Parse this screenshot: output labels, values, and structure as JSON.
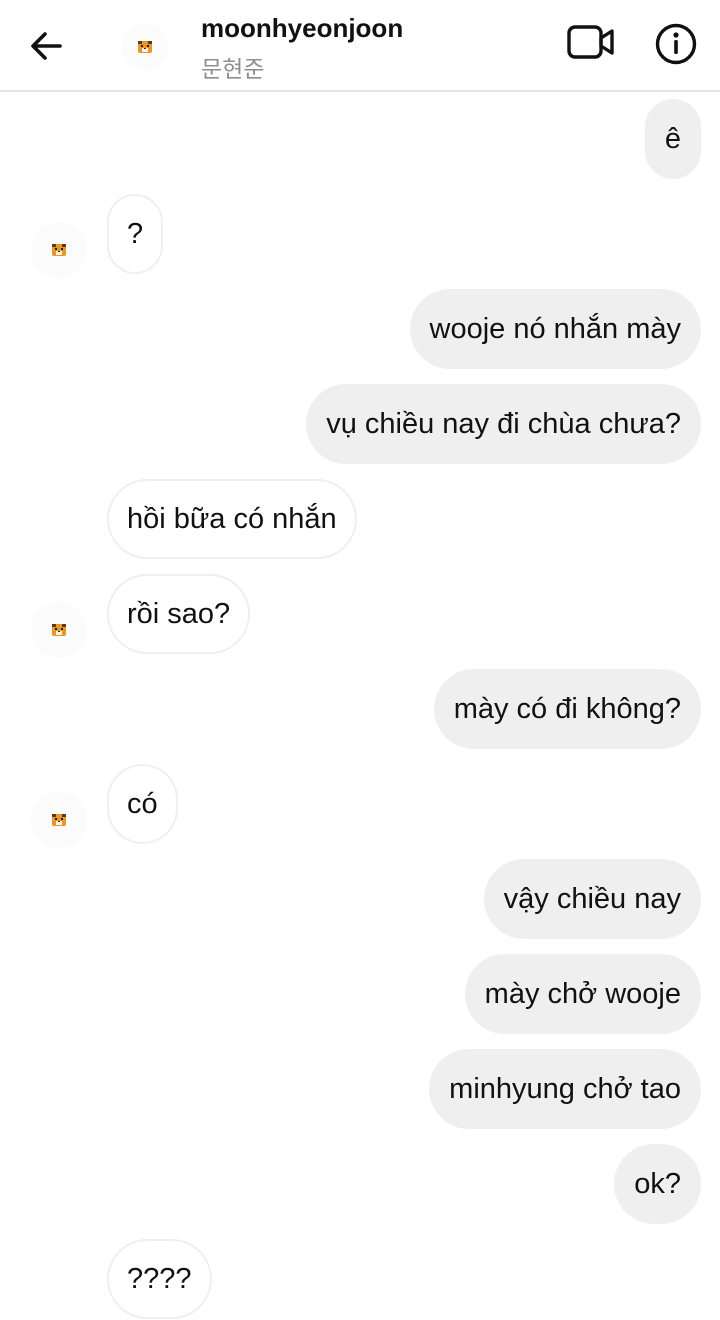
{
  "header": {
    "username": "moonhyeonjoon",
    "subname": "문현준"
  },
  "icons": {
    "back": "arrow-left-icon",
    "video": "video-camera-icon",
    "info": "info-icon",
    "avatar": "tiger-avatar-icon"
  },
  "colors": {
    "my_bubble": "#efefef",
    "their_bubble_border": "#efefef",
    "avatar_orange": "#e8952a"
  },
  "messages": [
    {
      "sender": "me",
      "text": "ê"
    },
    {
      "sender": "them",
      "text": "?"
    },
    {
      "sender": "me",
      "text": "wooje nó nhắn mày"
    },
    {
      "sender": "me",
      "text": "vụ chiều nay đi chùa chưa?"
    },
    {
      "sender": "them",
      "text": "hồi bữa có nhắn"
    },
    {
      "sender": "them",
      "text": "rồi sao?"
    },
    {
      "sender": "me",
      "text": "mày có đi không?"
    },
    {
      "sender": "them",
      "text": "có"
    },
    {
      "sender": "me",
      "text": "vậy chiều nay"
    },
    {
      "sender": "me",
      "text": "mày chở wooje"
    },
    {
      "sender": "me",
      "text": "minhyung chở tao"
    },
    {
      "sender": "me",
      "text": "ok?"
    },
    {
      "sender": "them",
      "text": "????"
    }
  ]
}
